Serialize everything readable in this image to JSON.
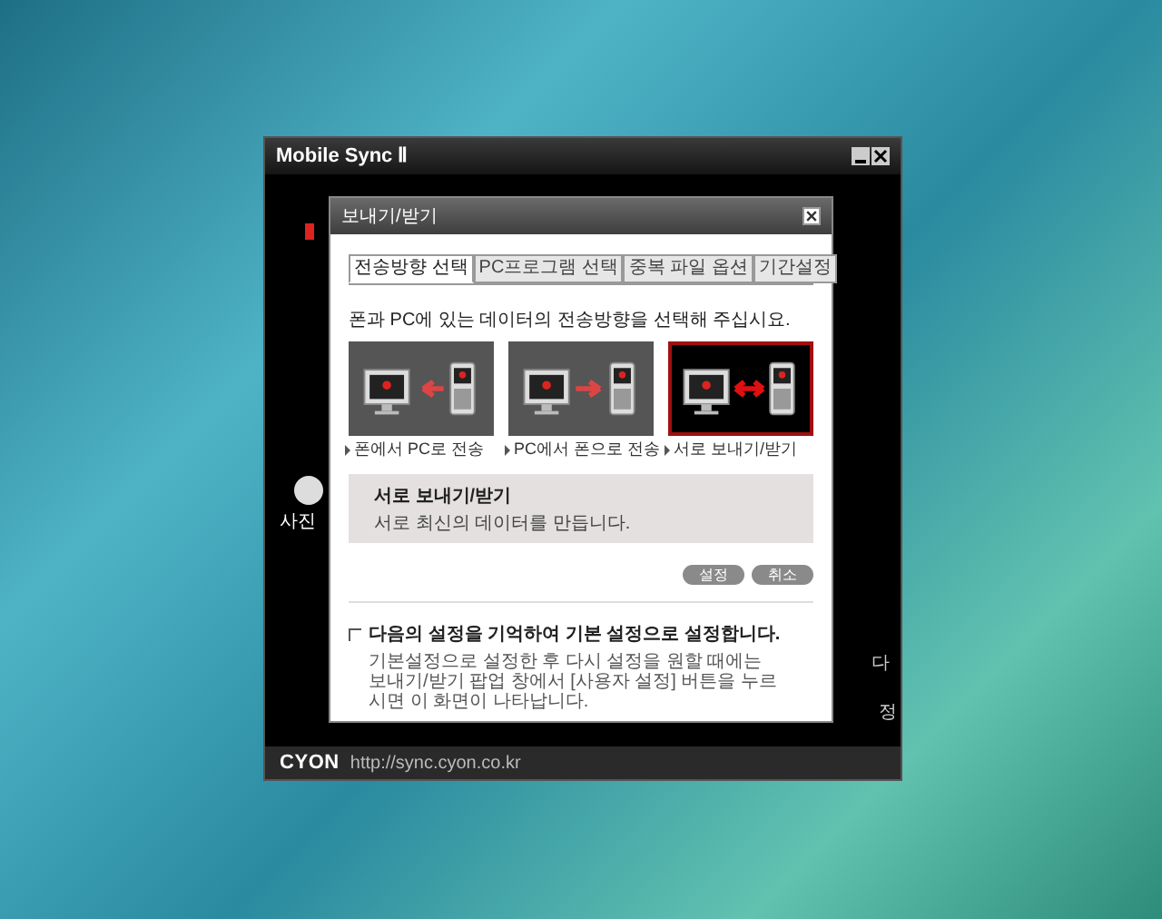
{
  "window": {
    "title": "Mobile Sync Ⅱ",
    "brand": "CYON",
    "url": "http://sync.cyon.co.kr"
  },
  "background_fragments": {
    "left": "사진",
    "right_top": "다",
    "right_bottom": "정"
  },
  "dialog": {
    "title": "보내기/받기",
    "tabs": [
      {
        "label": "전송방향 선택",
        "selected": true
      },
      {
        "label": "PC프로그램 선택",
        "selected": false
      },
      {
        "label": "중복 파일 옵션",
        "selected": false
      },
      {
        "label": "기간설정",
        "selected": false
      }
    ],
    "instruction": "폰과 PC에 있는 데이터의 전송방향을 선택해 주십시요.",
    "options": [
      {
        "kind": "to_pc",
        "label": "폰에서 PC로 전송",
        "selected": false
      },
      {
        "kind": "to_phone",
        "label": "PC에서 폰으로 전송",
        "selected": false
      },
      {
        "kind": "both",
        "label": "서로 보내기/받기",
        "selected": true
      }
    ],
    "description": {
      "title": "서로 보내기/받기",
      "text": "서로 최신의 데이터를 만듭니다."
    },
    "buttons": [
      "설정",
      "취소"
    ],
    "remember": {
      "label": "다음의 설정을 기억하여 기본 설정으로 설정합니다.",
      "checked": false,
      "note": "기본설정으로 설정한 후 다시 설정을 원할 때에는 보내기/받기 팝업 창에서 [사용자 설정] 버튼을 누르시면 이 화면이 나타납니다."
    }
  }
}
